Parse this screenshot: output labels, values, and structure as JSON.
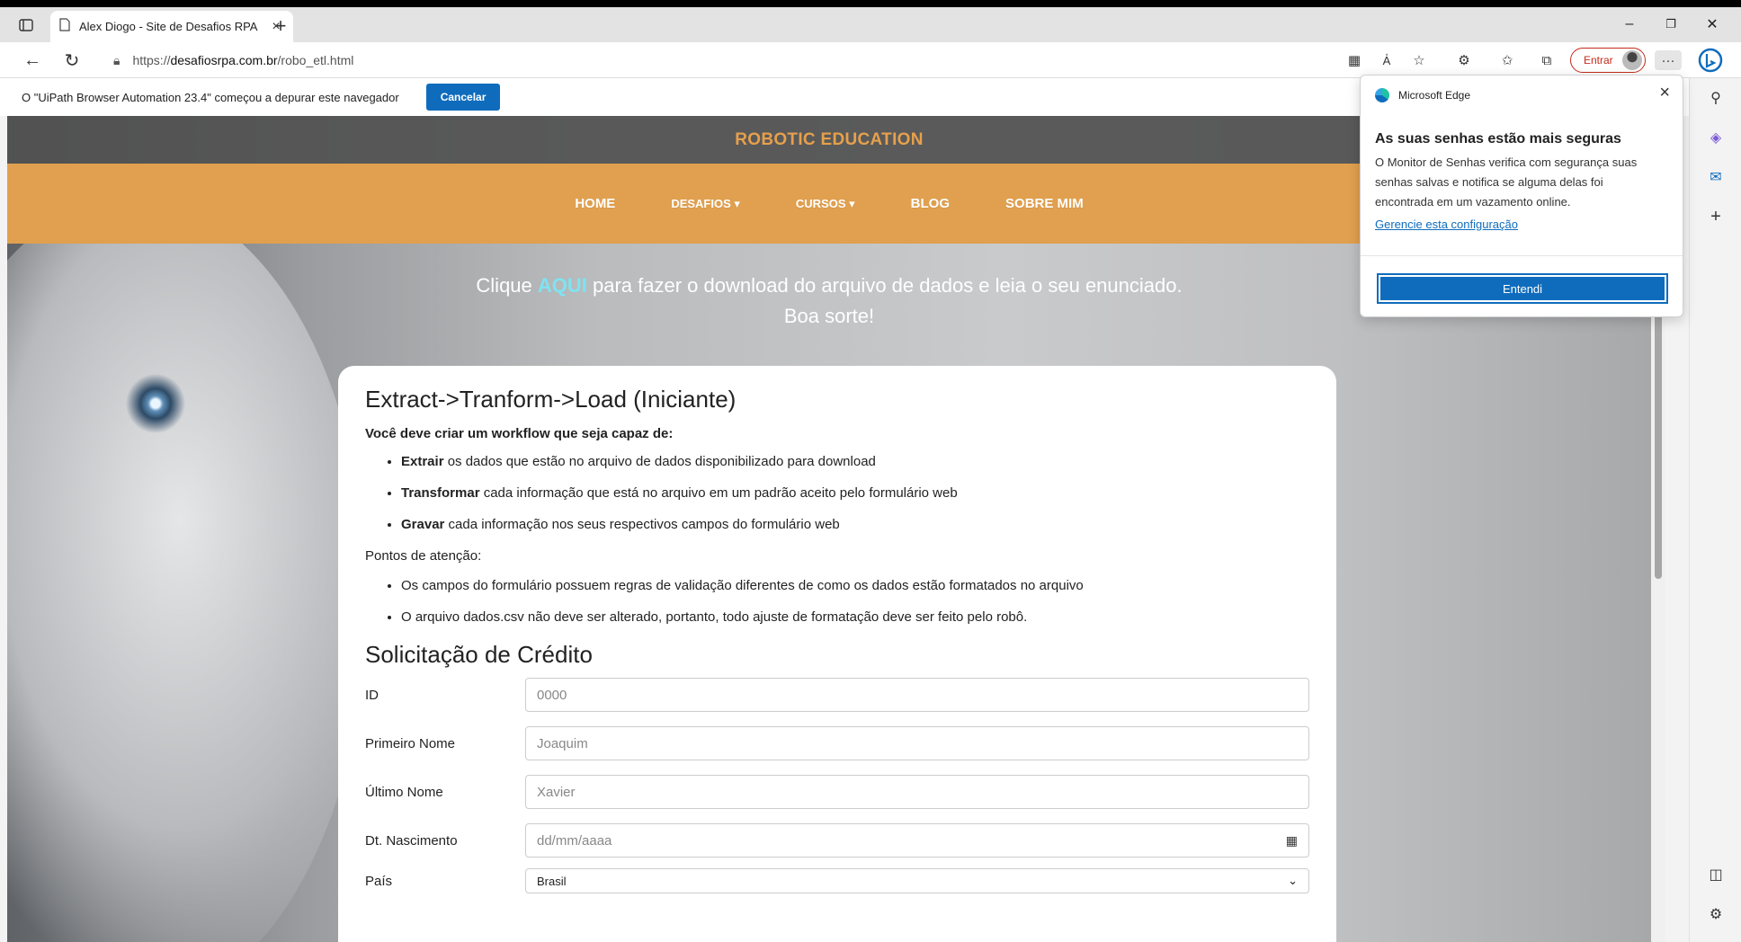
{
  "browser": {
    "tab_title": "Alex Diogo - Site de Desafios RPA",
    "new_tab": "+",
    "url_prefix": "https://",
    "url_host": "desafiosrpa.com.br",
    "url_path": "/robo_etl.html",
    "signin_label": "Entrar",
    "window_controls": {
      "minimize": "–",
      "restore": "❐",
      "close": "✕"
    }
  },
  "infobar": {
    "message": "O \"UiPath Browser Automation 23.4\" começou a depurar este navegador",
    "cancel_label": "Cancelar"
  },
  "site": {
    "brand": "ROBOTIC EDUCATION",
    "menu": [
      "HOME",
      "DESAFIOS ▾",
      "CURSOS ▾",
      "BLOG",
      "SOBRE MIM"
    ],
    "hero": {
      "before": "Clique ",
      "link": "AQUI",
      "after": " para fazer o download do arquivo de dados e leia o seu enunciado.",
      "line2": "Boa sorte!"
    }
  },
  "card": {
    "title": "Extract->Tranform->Load (Iniciante)",
    "intro": "Você deve criar um workflow que seja capaz de:",
    "steps": [
      {
        "bold": "Extrair",
        "text": " os dados que estão no arquivo de dados disponibilizado para download"
      },
      {
        "bold": "Transformar",
        "text": " cada informação que está no arquivo em um padrão aceito pelo formulário web"
      },
      {
        "bold": "Gravar",
        "text": " cada informação nos seus respectivos campos do formulário web"
      }
    ],
    "points_title": "Pontos de atenção:",
    "points": [
      "Os campos do formulário possuem regras de validação diferentes de como os dados estão formatados no arquivo",
      "O arquivo dados.csv não deve ser alterado, portanto, todo ajuste de formatação deve ser feito pelo robô."
    ],
    "form_title": "Solicitação de Crédito",
    "fields": [
      {
        "label": "ID",
        "placeholder": "0000"
      },
      {
        "label": "Primeiro Nome",
        "placeholder": "Joaquim"
      },
      {
        "label": "Último Nome",
        "placeholder": "Xavier"
      },
      {
        "label": "Dt. Nascimento",
        "placeholder": "dd/mm/aaaa"
      }
    ],
    "country_label": "País",
    "country_value": "Brasil"
  },
  "popup": {
    "app": "Microsoft Edge",
    "title": "As suas senhas estão mais seguras",
    "body": "O Monitor de Senhas verifica com segurança suas senhas salvas e notifica se alguma delas foi encontrada em um vazamento online.",
    "link": "Gerencie esta configuração",
    "button": "Entendi"
  },
  "colors": {
    "accent": "#0f6cbd",
    "brand": "#e6a04c",
    "menu_bg": "#e0a04f",
    "aqui": "#7fe3f2"
  }
}
